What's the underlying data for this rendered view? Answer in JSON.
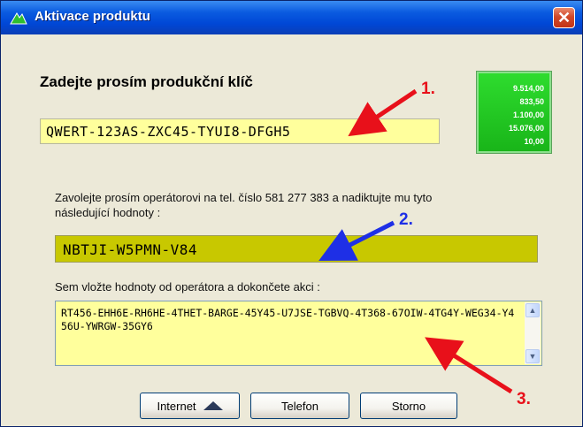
{
  "window": {
    "title": "Aktivace produktu",
    "close_label": "✕"
  },
  "main": {
    "heading": "Zadejte prosím produkční klíč",
    "product_key": "QWERT-123AS-ZXC45-TYUI8-DFGH5",
    "instructions": "Zavolejte prosím operátorovi na tel. číslo 581 277 383 a nadiktujte mu tyto následující hodnoty :",
    "installation_code": "NBTJI-W5PMN-V84",
    "paste_label": "Sem vložte hodnoty od operátora a dokončete akci :",
    "confirmation_value": "RT456-EHH6E-RH6HE-4THET-BARGE-45Y45-U7JSE-TGBVQ-4T368-67OIW-4TG4Y-WEG34-Y456U-YWRGW-35GY6"
  },
  "ticker": {
    "values": [
      "9.514,00",
      "833,50",
      "1.100,00",
      "15.076,00",
      "10,00"
    ]
  },
  "buttons": {
    "internet": "Internet",
    "telefon": "Telefon",
    "storno": "Storno"
  },
  "annotations": {
    "one": "1.",
    "two": "2.",
    "three": "3."
  },
  "colors": {
    "key_field": "#FFFF9C",
    "code_field": "#C8C800",
    "arrow_red": "#E8101A",
    "arrow_blue": "#1E2FE6",
    "ticker_green": "#22CC22"
  }
}
